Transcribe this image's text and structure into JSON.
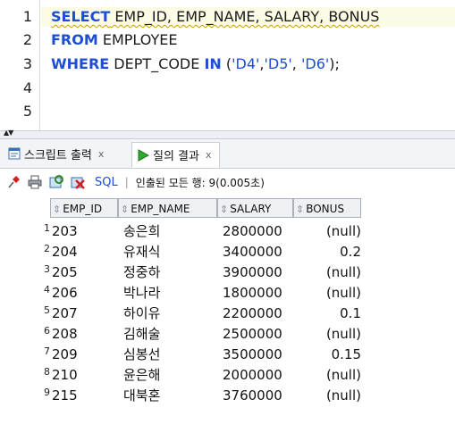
{
  "editor": {
    "line_numbers": [
      "1",
      "2",
      "3",
      "4",
      "5"
    ],
    "lines": [
      {
        "kw1": "SELECT",
        "rest": " EMP_ID, EMP_NAME, SALARY, BONUS"
      },
      {
        "kw1": "FROM",
        "rest": " EMPLOYEE"
      },
      {
        "kw1": "WHERE",
        "rest": " DEPT_CODE ",
        "kw2": "IN",
        "rest2": " (",
        "s1": "'D4'",
        ",": ",",
        "s2": "'D5'",
        "c2": ", ",
        "s3": "'D6'",
        "end": ");"
      }
    ]
  },
  "tabs": [
    {
      "label": "스크립트 출력",
      "close": "x"
    },
    {
      "label": "질의 결과",
      "close": "x"
    }
  ],
  "toolbar": {
    "sql_label": "SQL",
    "separator": "|",
    "fetch_text": "인출된 모든 행: 9(0.005초)"
  },
  "grid": {
    "headers": [
      "EMP_ID",
      "EMP_NAME",
      "SALARY",
      "BONUS"
    ],
    "rows": [
      {
        "n": "1",
        "id": "203",
        "name": "송은희",
        "salary": "2800000",
        "bonus": "(null)"
      },
      {
        "n": "2",
        "id": "204",
        "name": "유재식",
        "salary": "3400000",
        "bonus": "0.2"
      },
      {
        "n": "3",
        "id": "205",
        "name": "정중하",
        "salary": "3900000",
        "bonus": "(null)"
      },
      {
        "n": "4",
        "id": "206",
        "name": "박나라",
        "salary": "1800000",
        "bonus": "(null)"
      },
      {
        "n": "5",
        "id": "207",
        "name": "하이유",
        "salary": "2200000",
        "bonus": "0.1"
      },
      {
        "n": "6",
        "id": "208",
        "name": "김해술",
        "salary": "2500000",
        "bonus": "(null)"
      },
      {
        "n": "7",
        "id": "209",
        "name": "심봉선",
        "salary": "3500000",
        "bonus": "0.15"
      },
      {
        "n": "8",
        "id": "210",
        "name": "윤은해",
        "salary": "2000000",
        "bonus": "(null)"
      },
      {
        "n": "9",
        "id": "215",
        "name": "대북혼",
        "salary": "3760000",
        "bonus": "(null)"
      }
    ]
  },
  "colors": {
    "keyword": "#1c4fd6",
    "current_line": "#fbfbe6"
  }
}
